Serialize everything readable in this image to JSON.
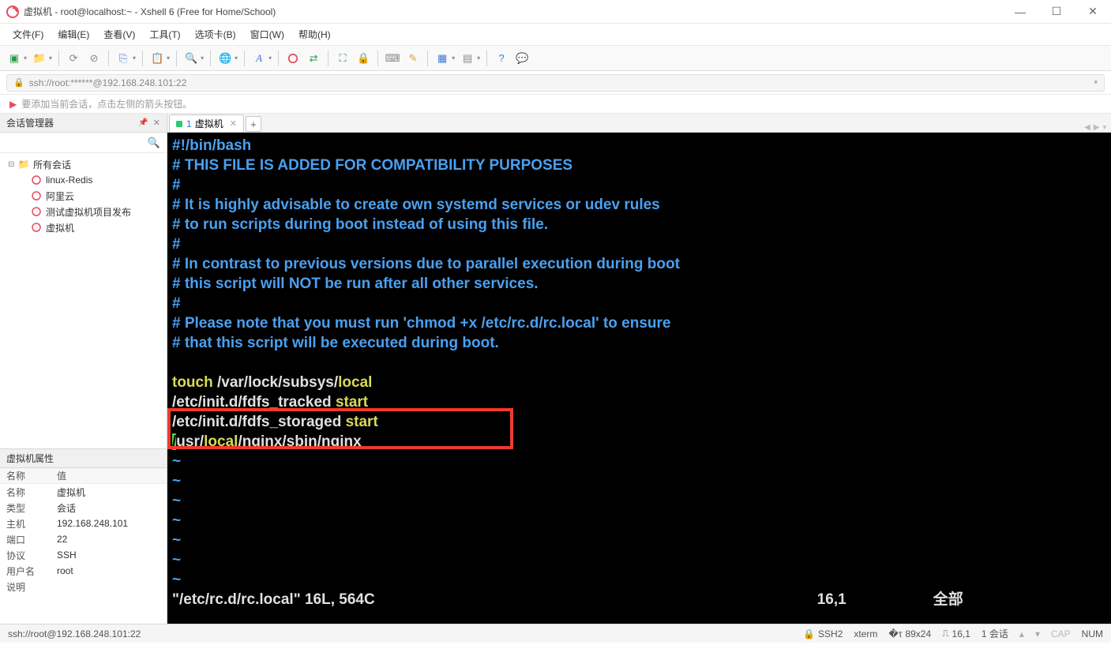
{
  "title": "虚拟机 - root@localhost:~ - Xshell 6 (Free for Home/School)",
  "menu": [
    "文件(F)",
    "编辑(E)",
    "查看(V)",
    "工具(T)",
    "选项卡(B)",
    "窗口(W)",
    "帮助(H)"
  ],
  "address": "ssh://root:******@192.168.248.101:22",
  "notice": "要添加当前会话，点击左侧的箭头按钮。",
  "session_panel_title": "会话管理器",
  "tree_root": "所有会话",
  "sessions": [
    "linux-Redis",
    "阿里云",
    "测试虚拟机项目发布",
    "虚拟机"
  ],
  "props_panel_title": "虚拟机属性",
  "props_headers": {
    "name": "名称",
    "value": "值"
  },
  "props": [
    {
      "k": "名称",
      "v": "虚拟机"
    },
    {
      "k": "类型",
      "v": "会话"
    },
    {
      "k": "主机",
      "v": "192.168.248.101"
    },
    {
      "k": "端口",
      "v": "22"
    },
    {
      "k": "协议",
      "v": "SSH"
    },
    {
      "k": "用户名",
      "v": "root"
    },
    {
      "k": "说明",
      "v": ""
    }
  ],
  "tab": {
    "num": "1",
    "label": "虚拟机"
  },
  "terminal": {
    "l01": "#!/bin/bash",
    "l02": "# THIS FILE IS ADDED FOR COMPATIBILITY PURPOSES",
    "l03": "#",
    "l04": "# It is highly advisable to create own systemd services or udev rules",
    "l05": "# to run scripts during boot instead of using this file.",
    "l06": "#",
    "l07": "# In contrast to previous versions due to parallel execution during boot",
    "l08": "# this script will NOT be run after all other services.",
    "l09": "#",
    "l10": "# Please note that you must run 'chmod +x /etc/rc.d/rc.local' to ensure",
    "l11": "# that this script will be executed during boot.",
    "touch_cmd": "touch",
    "touch_path1": " /var/lock/subsys/",
    "touch_path2": "local",
    "trk_path": "/etc/init.d/fdfs_tracked ",
    "trk_arg": "start",
    "stg_path": "/etc/init.d/fdfs_storaged ",
    "stg_arg": "start",
    "ng1": "/",
    "ng2": "usr",
    "ng3": "/",
    "ng4": "local",
    "ng5": "/nginx/sbin/nginx",
    "tilde": "~",
    "status_file": "\"/etc/rc.d/rc.local\" 16L, 564C",
    "status_pos": "16,1",
    "status_all": "全部"
  },
  "status": {
    "addr": "ssh://root@192.168.248.101:22",
    "ssh": "SSH2",
    "term": "xterm",
    "size": "89x24",
    "pos": "16,1",
    "sess": "1 会话",
    "cap": "CAP",
    "num": "NUM"
  }
}
